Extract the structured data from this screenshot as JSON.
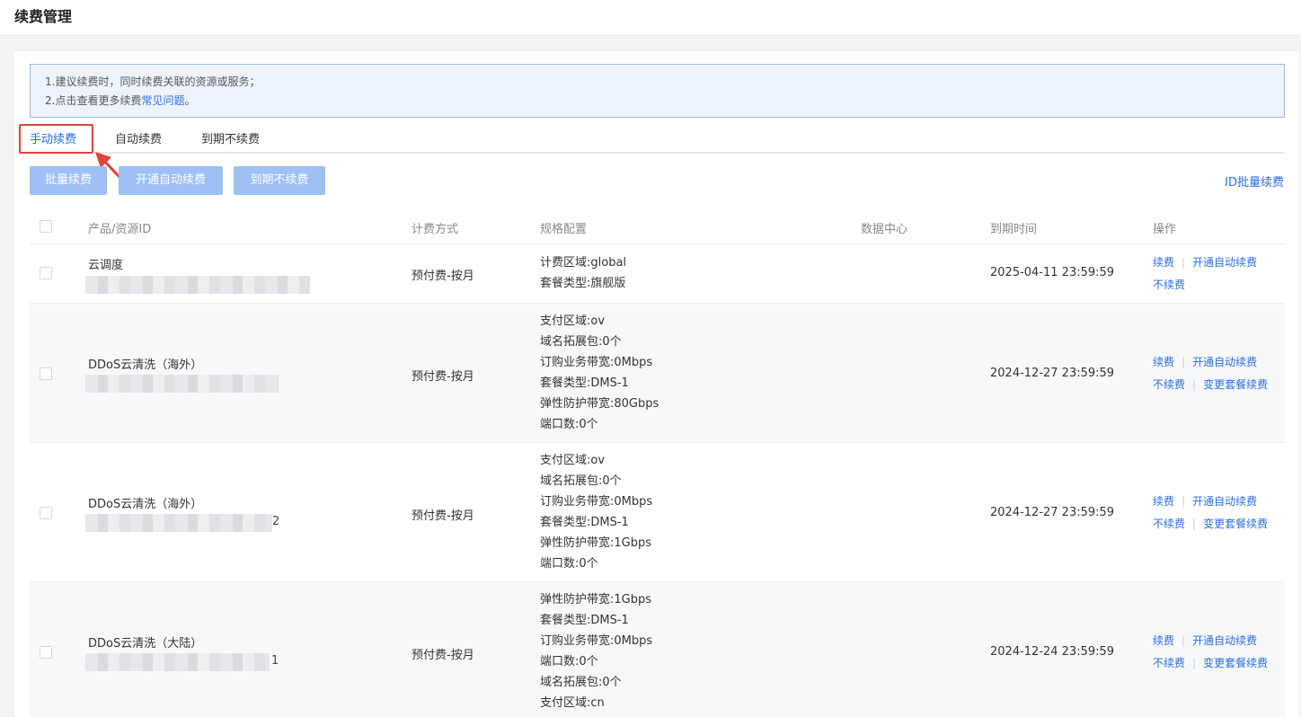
{
  "header": {
    "title": "续费管理"
  },
  "notice": {
    "line1": "1.建议续费时，同时续费关联的资源或服务；",
    "line2_prefix": "2.点击查看更多续费",
    "line2_link": "常见问题",
    "line2_suffix": "。"
  },
  "tabs": [
    {
      "label": "手动续费",
      "active": true
    },
    {
      "label": "自动续费",
      "active": false
    },
    {
      "label": "到期不续费",
      "active": false
    }
  ],
  "toolbar": {
    "batch_renew": "批量续费",
    "enable_auto_renew": "开通自动续费",
    "no_renew": "到期不续费",
    "id_batch_renew": "ID批量续费"
  },
  "table": {
    "columns": [
      "产品/资源ID",
      "计费方式",
      "规格配置",
      "数据中心",
      "到期时间",
      "操作"
    ],
    "rows": [
      {
        "product": "云调度",
        "id_suffix": "",
        "billing": "预付费-按月",
        "spec": [
          "计费区域:global",
          "套餐类型:旗舰版"
        ],
        "datacenter": "",
        "expire": "2025-04-11 23:59:59",
        "ops": {
          "renew": "续费",
          "auto_renew": "开通自动续费",
          "no_renew": "不续费",
          "change_pkg": ""
        }
      },
      {
        "product": "DDoS云清洗（海外）",
        "id_suffix": "",
        "billing": "预付费-按月",
        "spec": [
          "支付区域:ov",
          "域名拓展包:0个",
          "订购业务带宽:0Mbps",
          "套餐类型:DMS-1",
          "弹性防护带宽:80Gbps",
          "端口数:0个"
        ],
        "datacenter": "",
        "expire": "2024-12-27 23:59:59",
        "ops": {
          "renew": "续费",
          "auto_renew": "开通自动续费",
          "no_renew": "不续费",
          "change_pkg": "变更套餐续费"
        }
      },
      {
        "product": "DDoS云清洗（海外）",
        "id_suffix": "2",
        "billing": "预付费-按月",
        "spec": [
          "支付区域:ov",
          "域名拓展包:0个",
          "订购业务带宽:0Mbps",
          "套餐类型:DMS-1",
          "弹性防护带宽:1Gbps",
          "端口数:0个"
        ],
        "datacenter": "",
        "expire": "2024-12-27 23:59:59",
        "ops": {
          "renew": "续费",
          "auto_renew": "开通自动续费",
          "no_renew": "不续费",
          "change_pkg": "变更套餐续费"
        }
      },
      {
        "product": "DDoS云清洗（大陆）",
        "id_suffix": "1",
        "billing": "预付费-按月",
        "spec": [
          "弹性防护带宽:1Gbps",
          "套餐类型:DMS-1",
          "订购业务带宽:0Mbps",
          "端口数:0个",
          "域名拓展包:0个",
          "支付区域:cn"
        ],
        "datacenter": "",
        "expire": "2024-12-24 23:59:59",
        "ops": {
          "renew": "续费",
          "auto_renew": "开通自动续费",
          "no_renew": "不续费",
          "change_pkg": "变更套餐续费"
        }
      }
    ]
  },
  "colors": {
    "accent": "#2a6ee8",
    "button": "#9ec0f4",
    "highlight": "#e0433b",
    "notice_bg": "#eef4fe"
  }
}
